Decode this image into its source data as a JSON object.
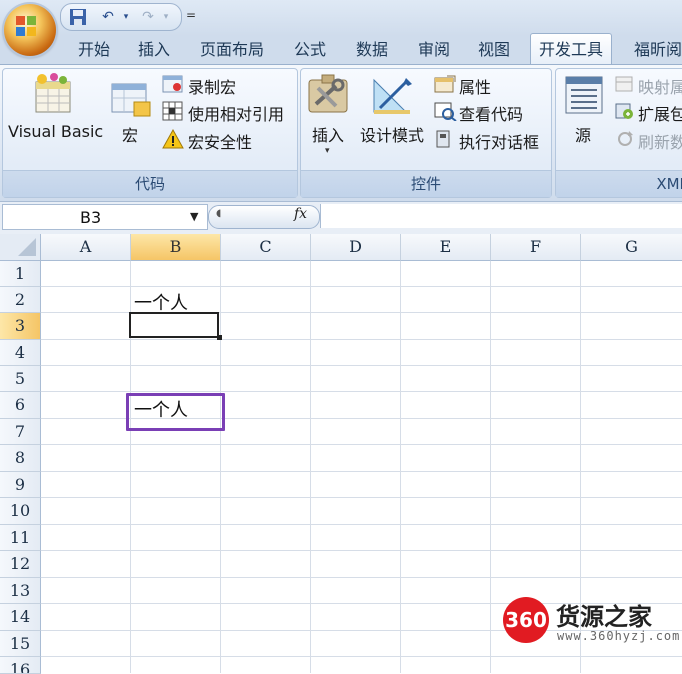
{
  "quick_access": {
    "customize_label": "="
  },
  "tabs": [
    "开始",
    "插入",
    "页面布局",
    "公式",
    "数据",
    "审阅",
    "视图",
    "开发工具",
    "福昕阅"
  ],
  "active_tab": "开发工具",
  "ribbon": {
    "code_group": {
      "label": "代码",
      "visual_basic": "Visual Basic",
      "macros": "宏",
      "record_macro": "录制宏",
      "relative_ref": "使用相对引用",
      "macro_security": "宏安全性"
    },
    "controls_group": {
      "label": "控件",
      "insert": "插入",
      "design_mode": "设计模式",
      "properties": "属性",
      "view_code": "查看代码",
      "run_dialog": "执行对话框"
    },
    "xml_group": {
      "label": "XMI",
      "source": "源",
      "map_properties": "映射属",
      "expansion_packs": "扩展包",
      "refresh_data": "刷新数"
    }
  },
  "formula_bar": {
    "name_box": "B3",
    "fx": "fx",
    "content": ""
  },
  "columns": [
    "A",
    "B",
    "C",
    "D",
    "E",
    "F",
    "G"
  ],
  "selected_column": "B",
  "rows": [
    "1",
    "2",
    "3",
    "4",
    "5",
    "6",
    "7",
    "8",
    "9",
    "10",
    "11",
    "12",
    "13",
    "14",
    "15",
    "16"
  ],
  "selected_row": "3",
  "cells": {
    "B2": "一个人",
    "B6": "一个人"
  },
  "watermark": {
    "badge": "360",
    "title": "货源之家",
    "url": "www.360hyzj.com"
  }
}
